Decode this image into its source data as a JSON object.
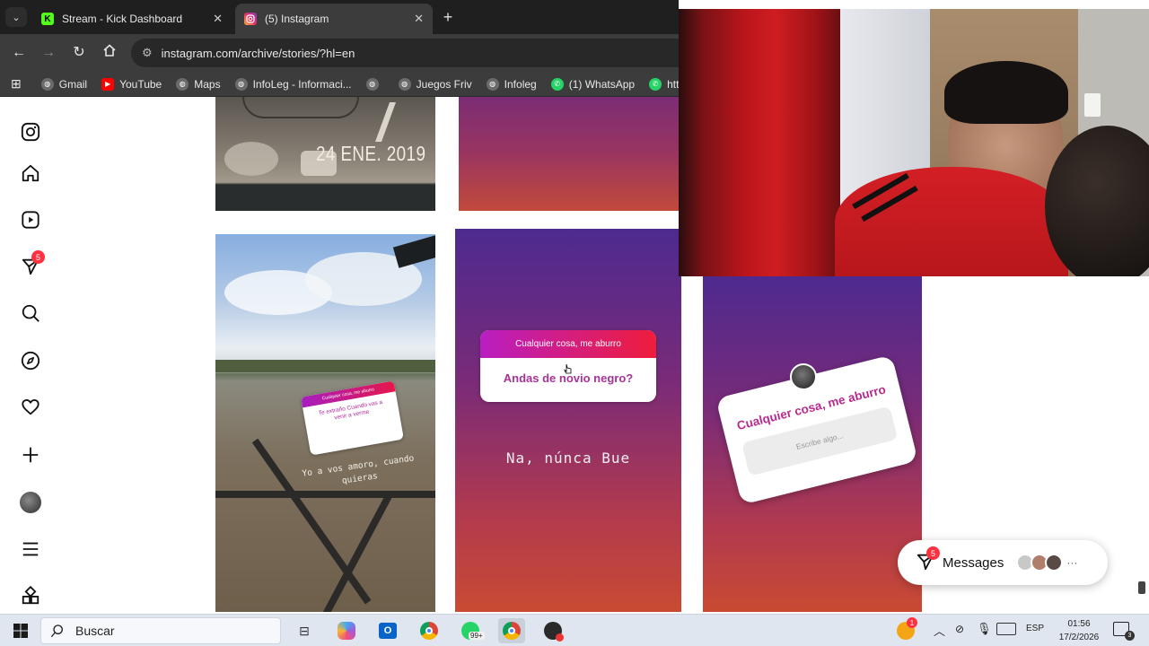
{
  "browser": {
    "tabs": [
      {
        "title": "Stream - Kick Dashboard",
        "favicon": "K",
        "active": false
      },
      {
        "title": "(5) Instagram",
        "favicon": "instagram-icon",
        "active": true
      }
    ],
    "url": "instagram.com/archive/stories/?hl=en",
    "bookmarks": [
      "Gmail",
      "YouTube",
      "Maps",
      "InfoLeg - Informaci...",
      "",
      "Juegos Friv",
      "Infoleg",
      "(1) WhatsApp",
      "http"
    ]
  },
  "instagram": {
    "sidebar_badge": "5",
    "tiles": {
      "photo_date": "24 ENE. 2019",
      "river_sticker_header": "Cualquier cosa, me aburro",
      "river_sticker_body": "Te extraño Cuando vas a venir a verme",
      "river_caption": "Yo a vos amoro, cuando quieras",
      "question_header": "Cualquier cosa, me aburro",
      "question_answer": "Andas de novio negro?",
      "reply_text": "Na, núnca Bue",
      "sticker_title": "Cualquier cosa, me aburro",
      "sticker_placeholder": "Escribe algo..."
    },
    "messages": {
      "label": "Messages",
      "badge": "5",
      "more": "···"
    }
  },
  "taskbar": {
    "search_placeholder": "Buscar",
    "whatsapp_badge": "99+",
    "notif_badge": "1",
    "language": "ESP",
    "time": "01:56",
    "date": "17/2/2026",
    "notification_count": "3"
  },
  "colors": {
    "chrome_dark": "#1f1f1f",
    "chrome_toolbar": "#3c3c3c",
    "instagram_red": "#ff3040",
    "story_gradient_top": "#4e2a8f",
    "story_gradient_bottom": "#c94a32"
  }
}
